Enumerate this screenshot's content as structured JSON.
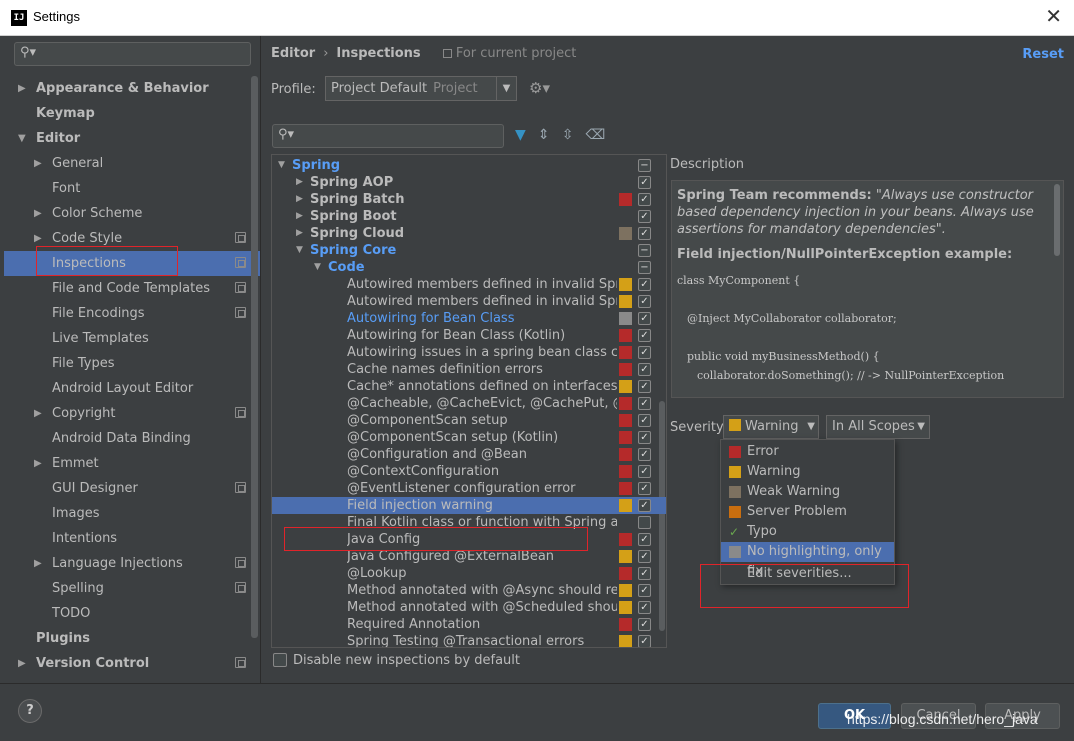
{
  "window": {
    "title": "Settings",
    "icon_text": "IJ",
    "close": "✕"
  },
  "left": {
    "search_placeholder": "",
    "items": [
      {
        "label": "Appearance & Behavior",
        "arrow": "▶",
        "level": 0,
        "bold": true
      },
      {
        "label": "Keymap",
        "arrow": "",
        "level": 0,
        "bold": true
      },
      {
        "label": "Editor",
        "arrow": "▼",
        "level": 0,
        "bold": true
      },
      {
        "label": "General",
        "arrow": "▶",
        "level": 1
      },
      {
        "label": "Font",
        "arrow": "",
        "level": 1
      },
      {
        "label": "Color Scheme",
        "arrow": "▶",
        "level": 1
      },
      {
        "label": "Code Style",
        "arrow": "▶",
        "level": 1,
        "proj": true
      },
      {
        "label": "Inspections",
        "arrow": "",
        "level": 1,
        "proj": true,
        "selected": true
      },
      {
        "label": "File and Code Templates",
        "arrow": "",
        "level": 1,
        "proj": true
      },
      {
        "label": "File Encodings",
        "arrow": "",
        "level": 1,
        "proj": true
      },
      {
        "label": "Live Templates",
        "arrow": "",
        "level": 1
      },
      {
        "label": "File Types",
        "arrow": "",
        "level": 1
      },
      {
        "label": "Android Layout Editor",
        "arrow": "",
        "level": 1
      },
      {
        "label": "Copyright",
        "arrow": "▶",
        "level": 1,
        "proj": true
      },
      {
        "label": "Android Data Binding",
        "arrow": "",
        "level": 1
      },
      {
        "label": "Emmet",
        "arrow": "▶",
        "level": 1
      },
      {
        "label": "GUI Designer",
        "arrow": "",
        "level": 1,
        "proj": true
      },
      {
        "label": "Images",
        "arrow": "",
        "level": 1
      },
      {
        "label": "Intentions",
        "arrow": "",
        "level": 1
      },
      {
        "label": "Language Injections",
        "arrow": "▶",
        "level": 1,
        "proj": true
      },
      {
        "label": "Spelling",
        "arrow": "",
        "level": 1,
        "proj": true
      },
      {
        "label": "TODO",
        "arrow": "",
        "level": 1
      },
      {
        "label": "Plugins",
        "arrow": "",
        "level": 0,
        "bold": true
      },
      {
        "label": "Version Control",
        "arrow": "▶",
        "level": 0,
        "bold": true,
        "proj": true
      }
    ],
    "help": "?"
  },
  "header": {
    "crumb1": "Editor",
    "sep": "›",
    "crumb2": "Inspections",
    "scope": "For current project",
    "reset": "Reset"
  },
  "profile": {
    "label": "Profile:",
    "value": "Project Default",
    "muted": "Project"
  },
  "tree": [
    {
      "label": "Spring",
      "arrow": "▼",
      "indent": 0,
      "blue": true,
      "bold": true,
      "sev": "",
      "check": "−"
    },
    {
      "label": "Spring AOP",
      "arrow": "▶",
      "indent": 1,
      "bold": true,
      "sev": "",
      "check": "✓"
    },
    {
      "label": "Spring Batch",
      "arrow": "▶",
      "indent": 1,
      "bold": true,
      "sev": "#b52a2a",
      "check": "✓"
    },
    {
      "label": "Spring Boot",
      "arrow": "▶",
      "indent": 1,
      "bold": true,
      "sev": "",
      "check": "✓"
    },
    {
      "label": "Spring Cloud",
      "arrow": "▶",
      "indent": 1,
      "bold": true,
      "sev": "#7d7160",
      "check": "✓"
    },
    {
      "label": "Spring Core",
      "arrow": "▼",
      "indent": 1,
      "blue": true,
      "bold": true,
      "sev": "",
      "check": "−"
    },
    {
      "label": "Code",
      "arrow": "▼",
      "indent": 2,
      "blue": true,
      "bold": true,
      "sev": "",
      "check": "−"
    },
    {
      "label": "Autowired members defined in invalid Spring bean",
      "indent": 3,
      "sev": "#d4a017",
      "check": "✓"
    },
    {
      "label": "Autowired members defined in invalid Spring bean",
      "indent": 3,
      "sev": "#d4a017",
      "check": "✓"
    },
    {
      "label": "Autowiring for Bean Class",
      "indent": 3,
      "blue": true,
      "sev": "#8a8a8a",
      "check": "✓"
    },
    {
      "label": "Autowiring for Bean Class (Kotlin)",
      "indent": 3,
      "sev": "#b52a2a",
      "check": "✓"
    },
    {
      "label": "Autowiring issues in a spring bean class constructor",
      "indent": 3,
      "sev": "#b52a2a",
      "check": "✓"
    },
    {
      "label": "Cache names definition errors",
      "indent": 3,
      "sev": "#b52a2a",
      "check": "✓"
    },
    {
      "label": "Cache* annotations defined on interfaces/interface methods",
      "indent": 3,
      "sev": "#d4a017",
      "check": "✓"
    },
    {
      "label": "@Cacheable, @CacheEvict, @CachePut, @Caching errors",
      "indent": 3,
      "sev": "#b52a2a",
      "check": "✓"
    },
    {
      "label": "@ComponentScan setup",
      "indent": 3,
      "sev": "#b52a2a",
      "check": "✓"
    },
    {
      "label": "@ComponentScan setup (Kotlin)",
      "indent": 3,
      "sev": "#b52a2a",
      "check": "✓"
    },
    {
      "label": "@Configuration and @Bean",
      "indent": 3,
      "sev": "#b52a2a",
      "check": "✓"
    },
    {
      "label": "@ContextConfiguration",
      "indent": 3,
      "sev": "#b52a2a",
      "check": "✓"
    },
    {
      "label": "@EventListener configuration error",
      "indent": 3,
      "sev": "#b52a2a",
      "check": "✓"
    },
    {
      "label": "Field injection warning",
      "indent": 3,
      "sev": "#d4a017",
      "check": "✓",
      "selected": true
    },
    {
      "label": "Final Kotlin class or function with Spring annotation",
      "indent": 3,
      "sev": "",
      "check": ""
    },
    {
      "label": "Java Config",
      "indent": 3,
      "sev": "#b52a2a",
      "check": "✓"
    },
    {
      "label": "Java Configured @ExternalBean",
      "indent": 3,
      "sev": "#d4a017",
      "check": "✓"
    },
    {
      "label": "@Lookup",
      "indent": 3,
      "sev": "#b52a2a",
      "check": "✓"
    },
    {
      "label": "Method annotated with @Async should return void",
      "indent": 3,
      "sev": "#d4a017",
      "check": "✓"
    },
    {
      "label": "Method annotated with @Scheduled should be void",
      "indent": 3,
      "sev": "#d4a017",
      "check": "✓"
    },
    {
      "label": "Required Annotation",
      "indent": 3,
      "sev": "#b52a2a",
      "check": "✓"
    },
    {
      "label": "Spring Testing  @Transactional errors",
      "indent": 3,
      "sev": "#d4a017",
      "check": "✓"
    }
  ],
  "disable_new": "Disable new inspections by default",
  "description": {
    "title": "Description",
    "recommend_bold": "Spring Team recommends:",
    "recommend_italic": "\"Always use constructor based dependency injection in your beans. Always use assertions for mandatory dependencies\".",
    "example_title": "Field injection/NullPointerException example:",
    "code1": "class MyComponent {",
    "code2": "@Inject MyCollaborator collaborator;",
    "code3": "public void myBusinessMethod() {",
    "code4": "collaborator.doSomething(); // -> NullPointerException"
  },
  "severity": {
    "label": "Severity:",
    "value": "Warning",
    "value_color": "#d4a017",
    "scope": "In All Scopes"
  },
  "severity_options": [
    {
      "label": "Error",
      "color": "#b52a2a"
    },
    {
      "label": "Warning",
      "color": "#d4a017"
    },
    {
      "label": "Weak Warning",
      "color": "#7d7160"
    },
    {
      "label": "Server Problem",
      "color": "#c96e0f"
    },
    {
      "label": "Typo",
      "color": "",
      "mark": "✓"
    },
    {
      "label": "No highlighting, only fix",
      "color": "#8a8a8a",
      "selected": true
    },
    {
      "label": "Edit severities...",
      "color": ""
    }
  ],
  "buttons": {
    "ok": "OK",
    "cancel": "Cancel",
    "apply": "Apply"
  },
  "watermark": "https://blog.csdn.net/hero_java"
}
